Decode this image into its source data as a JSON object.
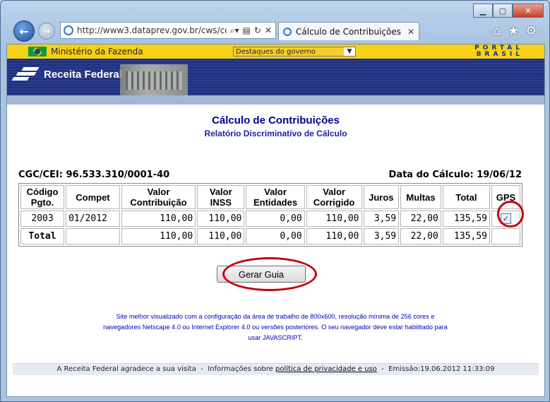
{
  "browser": {
    "address": "http://www3.dataprev.gov.br/cws/cc",
    "address_host": "dataprev.gov.br",
    "tab_title": "Cálculo de Contribuições p...",
    "icons": [
      "back-arrow-icon",
      "forward-arrow-icon",
      "search-icon",
      "compat-icon",
      "refresh-icon",
      "close-icon",
      "home-icon",
      "favorites-star-icon",
      "settings-gear-icon"
    ]
  },
  "govbar": {
    "ministry": "Ministério da Fazenda",
    "dropdown_value": "Destaques do governo",
    "portal_line1": "PORTAL",
    "portal_line2": "BRASIL"
  },
  "banner": {
    "brand": "Receita Federal"
  },
  "page": {
    "title": "Cálculo de Contribuições",
    "subtitle": "Relatório Discriminativo de Cálculo",
    "cgc_label": "CGC/CEI:",
    "cgc_value": "96.533.310/0001-40",
    "date_label": "Data do Cálculo:",
    "date_value": "19/06/12"
  },
  "table": {
    "headers": {
      "codigo_1": "Código",
      "codigo_2": "Pgto.",
      "compet": "Compet",
      "valor_contrib_1": "Valor",
      "valor_contrib_2": "Contribuição",
      "valor_inss_1": "Valor",
      "valor_inss_2": "INSS",
      "valor_entidades_1": "Valor",
      "valor_entidades_2": "Entidades",
      "valor_corrigido_1": "Valor",
      "valor_corrigido_2": "Corrigido",
      "juros": "Juros",
      "multas": "Multas",
      "total": "Total",
      "gps": "GPS"
    },
    "row": {
      "codigo": "2003",
      "compet": "01/2012",
      "valor_contrib": "110,00",
      "valor_inss": "110,00",
      "valor_entidades": "0,00",
      "valor_corrigido": "110,00",
      "juros": "3,59",
      "multas": "22,00",
      "total": "135,59",
      "gps_checked": true
    },
    "total_row": {
      "label": "Total",
      "valor_contrib": "110,00",
      "valor_inss": "110,00",
      "valor_entidades": "0,00",
      "valor_corrigido": "110,00",
      "juros": "3,59",
      "multas": "22,00",
      "total": "135,59"
    }
  },
  "actions": {
    "generate_button": "Gerar Guia"
  },
  "note": {
    "line1": "Site melhor visualizado com a configuração da área de trabalho de 800x600, resolução mínima de 256 cores e",
    "line2": "navegadores Netscape 4.0 ou Internet Explorer 4.0 ou versões posteriores.  O seu navegador deve estar habilitado para",
    "line3": "usar JAVASCRIPT."
  },
  "footer": {
    "thanks": "A Receita Federal agradece a sua visita",
    "info_prefix": "Informações sobre",
    "privacy_link": "política de privacidade e uso",
    "emission": "Emissão:19.06.2012 11:33:09"
  },
  "colors": {
    "annotation_red": "#c00013",
    "title_blue": "#00008b",
    "gov_yellow": "#f7d117",
    "banner_blue": "#20307f"
  }
}
